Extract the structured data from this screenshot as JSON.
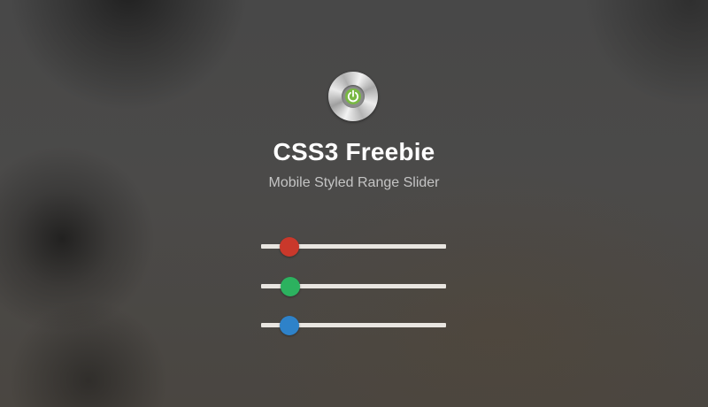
{
  "header": {
    "title": "CSS3 Freebie",
    "subtitle": "Mobile Styled Range Slider",
    "icon": "power-icon"
  },
  "sliders": [
    {
      "name": "red",
      "color": "#c9382b",
      "value": 0.155
    },
    {
      "name": "green",
      "color": "#2cb25f",
      "value": 0.16
    },
    {
      "name": "blue",
      "color": "#2e82c9",
      "value": 0.155
    }
  ],
  "colors": {
    "icon_green": "#79b843",
    "track": "#e9e6e1"
  }
}
